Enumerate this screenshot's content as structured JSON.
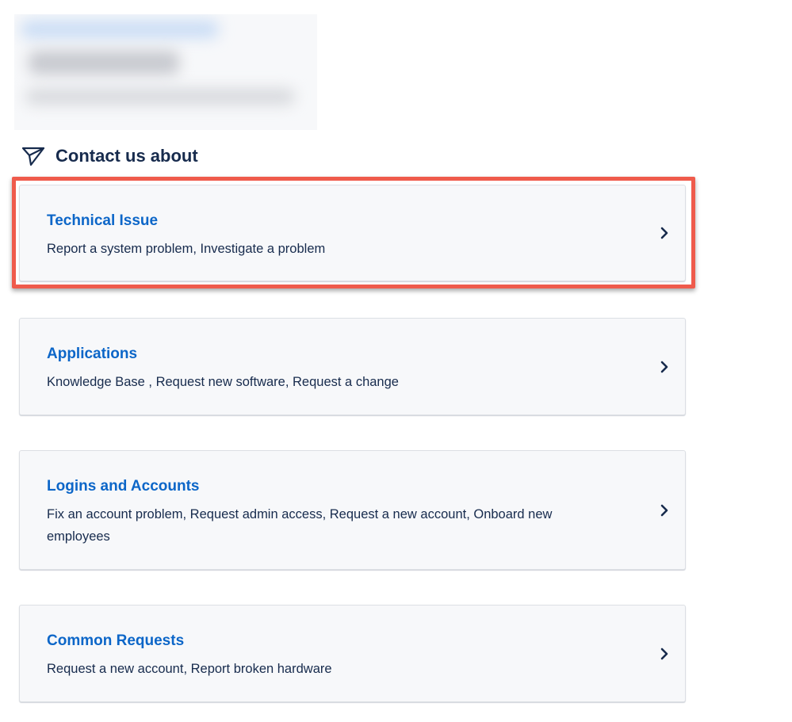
{
  "section": {
    "heading": "Contact us about",
    "icon": "send-icon"
  },
  "accent_color": "#0c66c8",
  "highlight_color": "#ef5b4c",
  "cards": [
    {
      "title": "Technical Issue",
      "description": "Report a system problem, Investigate a problem",
      "icon": "chevron-right-icon",
      "highlighted": true
    },
    {
      "title": "Applications",
      "description": "Knowledge Base , Request new software, Request a change",
      "icon": "chevron-right-icon"
    },
    {
      "title": "Logins and Accounts",
      "description": "Fix an account problem, Request admin access, Request a new account, Onboard new employees",
      "icon": "chevron-right-icon"
    },
    {
      "title": "Common Requests",
      "description": "Request a new account, Report broken hardware",
      "icon": "chevron-right-icon"
    }
  ]
}
